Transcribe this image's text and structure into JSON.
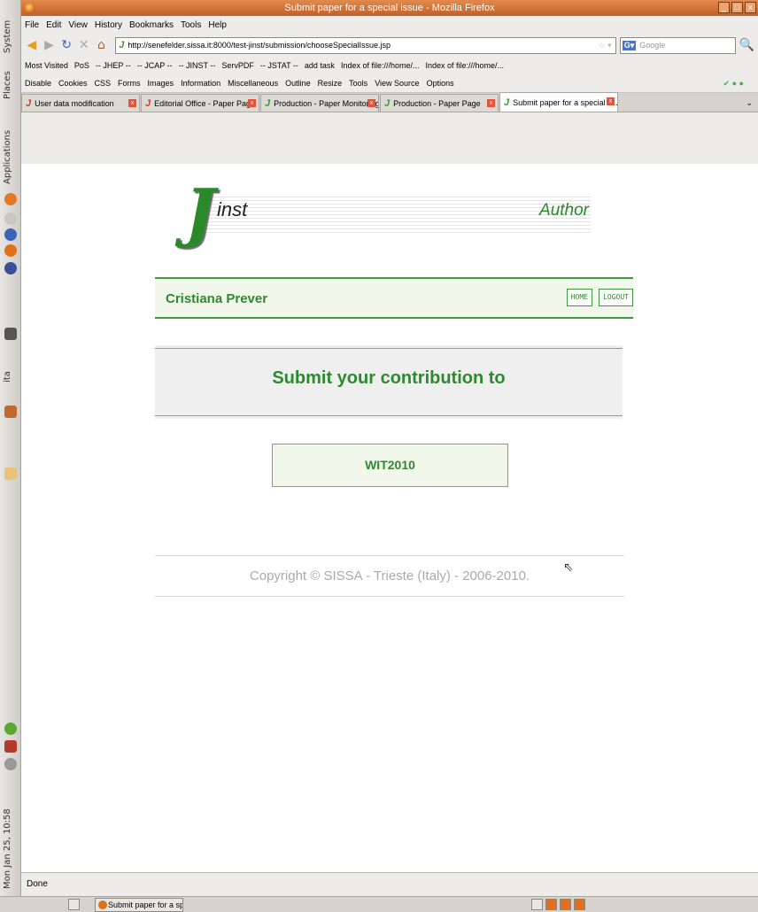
{
  "panel": {
    "system": "System",
    "places": "Places",
    "applications": "Applications",
    "ita": "ita",
    "clock": "Mon Jan 25, 10:58"
  },
  "window": {
    "title": "Submit paper for a special issue - Mozilla Firefox"
  },
  "menu": [
    "File",
    "Edit",
    "View",
    "History",
    "Bookmarks",
    "Tools",
    "Help"
  ],
  "nav": {
    "url": "http://senefelder.sissa.it:8000/test-jinst/submission/chooseSpecialIssue.jsp",
    "search_placeholder": "Google"
  },
  "bookmarks": [
    "Most Visited",
    "PoS",
    "-- JHEP --",
    "-- JCAP --",
    "-- JINST --",
    "ServPDF",
    "-- JSTAT --",
    "add task",
    "Index of file:///home/...",
    "Index of file:///home/..."
  ],
  "devtools": [
    "Disable",
    "Cookies",
    "CSS",
    "Forms",
    "Images",
    "Information",
    "Miscellaneous",
    "Outline",
    "Resize",
    "Tools",
    "View Source",
    "Options"
  ],
  "tabs": [
    {
      "label": "User data modification"
    },
    {
      "label": "Editorial Office - Paper Page"
    },
    {
      "label": "Production - Paper Monitoring"
    },
    {
      "label": "Production - Paper Page"
    },
    {
      "label": "Submit paper for a special is..."
    }
  ],
  "page": {
    "logo_text": "inst",
    "logo_letter": "J",
    "role": "Author",
    "user_name": "Cristiana Prever",
    "home_btn": "HOME",
    "logout_btn": "LOGOUT",
    "submit_title": "Submit your contribution to",
    "issue": "WIT2010",
    "copyright": "Copyright © SISSA - Trieste (Italy) - 2006-2010."
  },
  "status": {
    "text": "Done"
  },
  "taskbar": {
    "task": "Submit paper for a sp..."
  }
}
